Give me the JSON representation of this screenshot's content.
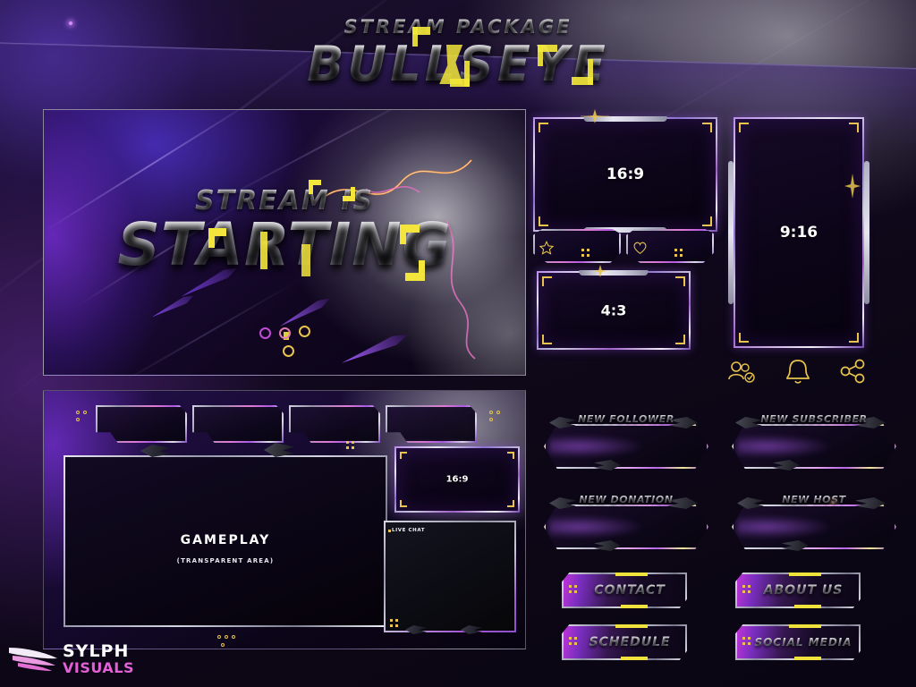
{
  "header": {
    "subtitle": "STREAM PACKAGE",
    "title": "BULLSEYE"
  },
  "starting_screen": {
    "line1": "STREAM IS",
    "line2": "STARTING"
  },
  "gameplay_overlay": {
    "title": "GAMEPLAY",
    "subtitle": "(TRANSPARENT AREA)",
    "webcam_label": "16:9",
    "chat_label": "LIVE CHAT",
    "topbar_widgets": [
      "widget-1",
      "widget-2",
      "widget-3",
      "widget-4"
    ]
  },
  "webcam_frames": {
    "wide": "16:9",
    "vertical": "9:16",
    "classic": "4:3",
    "small_star_icon": "star-icon",
    "small_heart_icon": "heart-icon"
  },
  "social_icons": [
    {
      "name": "follow-icon",
      "glyph": "follow"
    },
    {
      "name": "bell-icon",
      "glyph": "bell"
    },
    {
      "name": "share-icon",
      "glyph": "share"
    }
  ],
  "alerts": [
    {
      "label": "NEW FOLLOWER"
    },
    {
      "label": "NEW SUBSCRIBER"
    },
    {
      "label": "NEW DONATION"
    },
    {
      "label": "NEW HOST"
    }
  ],
  "panel_buttons": [
    {
      "label": "CONTACT"
    },
    {
      "label": "ABOUT US"
    },
    {
      "label": "SCHEDULE"
    },
    {
      "label": "SOCIAL MEDIA"
    }
  ],
  "logo": {
    "line1": "SYLPH",
    "line2": "VISUALS"
  },
  "colors": {
    "accent_yellow": "#f0e23c",
    "accent_gold": "#e8c44e",
    "accent_magenta": "#e45fd8",
    "accent_purple": "#8e4fd0",
    "chrome_light": "#e8e8f2",
    "bg_deep": "#0a0512"
  }
}
